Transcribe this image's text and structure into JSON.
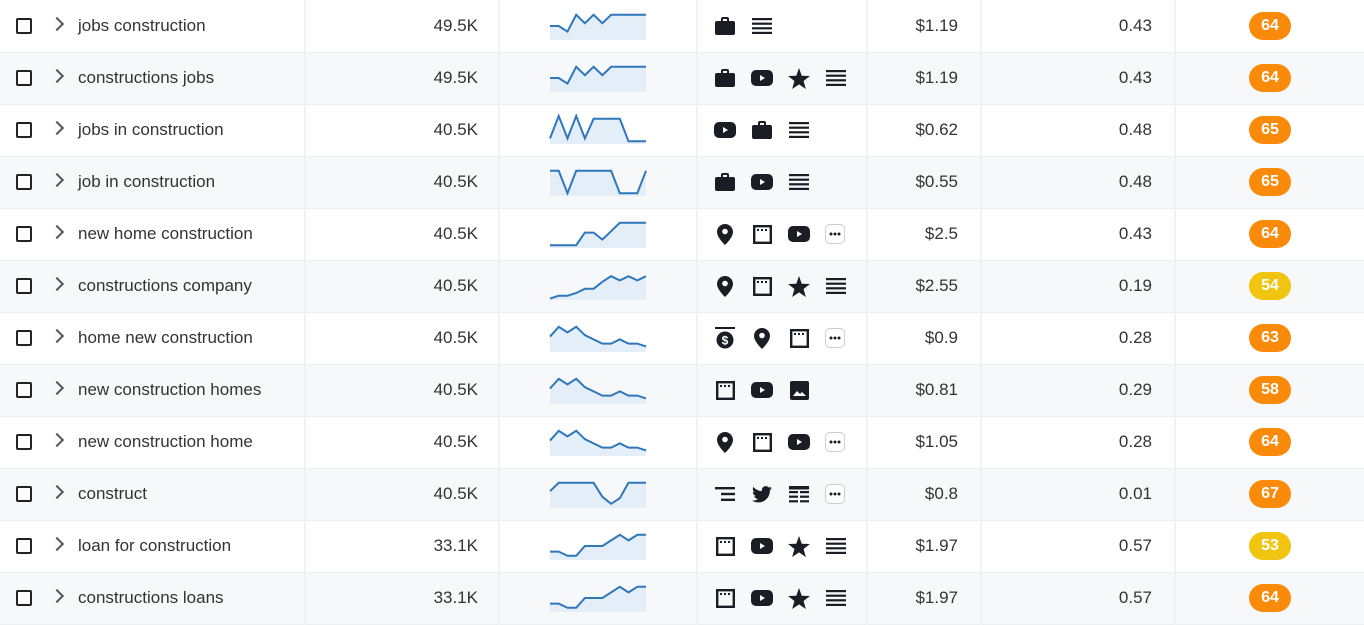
{
  "colors": {
    "orange": "#f98a0a",
    "yellow": "#f1c40f",
    "spark_line": "#2f77bb",
    "spark_fill": "#e3eef9"
  },
  "rows": [
    {
      "keyword": "jobs construction",
      "volume": "49.5K",
      "trend": [
        0.5,
        0.5,
        0.3,
        0.9,
        0.6,
        0.9,
        0.6,
        0.9,
        0.9,
        0.9,
        0.9,
        0.9
      ],
      "features": [
        "briefcase-icon",
        "list-icon"
      ],
      "cpc": "$1.19",
      "competition": "0.43",
      "kd": "64",
      "kd_color": "orange"
    },
    {
      "keyword": "constructions jobs",
      "volume": "49.5K",
      "trend": [
        0.5,
        0.5,
        0.3,
        0.9,
        0.6,
        0.9,
        0.6,
        0.9,
        0.9,
        0.9,
        0.9,
        0.9
      ],
      "features": [
        "briefcase-icon",
        "youtube-icon",
        "star-icon",
        "list-icon"
      ],
      "cpc": "$1.19",
      "competition": "0.43",
      "kd": "64",
      "kd_color": "orange"
    },
    {
      "keyword": "jobs in construction",
      "volume": "40.5K",
      "trend": [
        0.2,
        1,
        0.2,
        1,
        0.2,
        0.9,
        0.9,
        0.9,
        0.9,
        0.1,
        0.1,
        0.1
      ],
      "features": [
        "youtube-icon",
        "briefcase-icon",
        "list-icon"
      ],
      "cpc": "$0.62",
      "competition": "0.48",
      "kd": "65",
      "kd_color": "orange"
    },
    {
      "keyword": "job in construction",
      "volume": "40.5K",
      "trend": [
        0.9,
        0.9,
        0.1,
        0.9,
        0.9,
        0.9,
        0.9,
        0.9,
        0.1,
        0.1,
        0.1,
        0.9
      ],
      "features": [
        "briefcase-icon",
        "youtube-icon",
        "list-icon"
      ],
      "cpc": "$0.55",
      "competition": "0.48",
      "kd": "65",
      "kd_color": "orange"
    },
    {
      "keyword": "new home construction",
      "volume": "40.5K",
      "trend": [
        0.1,
        0.1,
        0.1,
        0.1,
        0.55,
        0.55,
        0.3,
        0.6,
        0.9,
        0.9,
        0.9,
        0.9
      ],
      "features": [
        "map-pin-icon",
        "browser-icon",
        "youtube-icon",
        "more-icon"
      ],
      "cpc": "$2.5",
      "competition": "0.43",
      "kd": "64",
      "kd_color": "orange"
    },
    {
      "keyword": "constructions company",
      "volume": "40.5K",
      "trend": [
        0.05,
        0.15,
        0.15,
        0.25,
        0.4,
        0.4,
        0.65,
        0.85,
        0.7,
        0.85,
        0.7,
        0.85
      ],
      "features": [
        "map-pin-icon",
        "browser-icon",
        "star-icon",
        "list-icon"
      ],
      "cpc": "$2.55",
      "competition": "0.19",
      "kd": "54",
      "kd_color": "yellow"
    },
    {
      "keyword": "home new construction",
      "volume": "40.5K",
      "trend": [
        0.55,
        0.9,
        0.7,
        0.9,
        0.6,
        0.45,
        0.3,
        0.3,
        0.45,
        0.3,
        0.3,
        0.2
      ],
      "features": [
        "dollar-sign-icon",
        "map-pin-icon",
        "browser-icon",
        "more-icon"
      ],
      "cpc": "$0.9",
      "competition": "0.28",
      "kd": "63",
      "kd_color": "orange"
    },
    {
      "keyword": "new construction homes",
      "volume": "40.5K",
      "trend": [
        0.55,
        0.9,
        0.7,
        0.9,
        0.6,
        0.45,
        0.3,
        0.3,
        0.45,
        0.3,
        0.3,
        0.2
      ],
      "features": [
        "browser-icon",
        "youtube-icon",
        "image-icon"
      ],
      "cpc": "$0.81",
      "competition": "0.29",
      "kd": "58",
      "kd_color": "orange"
    },
    {
      "keyword": "new construction home",
      "volume": "40.5K",
      "trend": [
        0.55,
        0.9,
        0.7,
        0.9,
        0.6,
        0.45,
        0.3,
        0.3,
        0.45,
        0.3,
        0.3,
        0.2
      ],
      "features": [
        "map-pin-icon",
        "browser-icon",
        "youtube-icon",
        "more-icon"
      ],
      "cpc": "$1.05",
      "competition": "0.28",
      "kd": "64",
      "kd_color": "orange"
    },
    {
      "keyword": "construct",
      "volume": "40.5K",
      "trend": [
        0.6,
        0.9,
        0.9,
        0.9,
        0.9,
        0.9,
        0.4,
        0.15,
        0.35,
        0.9,
        0.9,
        0.9
      ],
      "features": [
        "indent-list-icon",
        "twitter-icon",
        "table-icon",
        "more-icon"
      ],
      "cpc": "$0.8",
      "competition": "0.01",
      "kd": "67",
      "kd_color": "orange"
    },
    {
      "keyword": "loan for construction",
      "volume": "33.1K",
      "trend": [
        0.3,
        0.3,
        0.15,
        0.15,
        0.5,
        0.5,
        0.5,
        0.7,
        0.9,
        0.7,
        0.9,
        0.9
      ],
      "features": [
        "browser-icon",
        "youtube-icon",
        "star-icon",
        "list-icon"
      ],
      "cpc": "$1.97",
      "competition": "0.57",
      "kd": "53",
      "kd_color": "yellow"
    },
    {
      "keyword": "constructions loans",
      "volume": "33.1K",
      "trend": [
        0.3,
        0.3,
        0.15,
        0.15,
        0.5,
        0.5,
        0.5,
        0.7,
        0.9,
        0.7,
        0.9,
        0.9
      ],
      "features": [
        "browser-icon",
        "youtube-icon",
        "star-icon",
        "list-icon"
      ],
      "cpc": "$1.97",
      "competition": "0.57",
      "kd": "64",
      "kd_color": "orange"
    }
  ]
}
